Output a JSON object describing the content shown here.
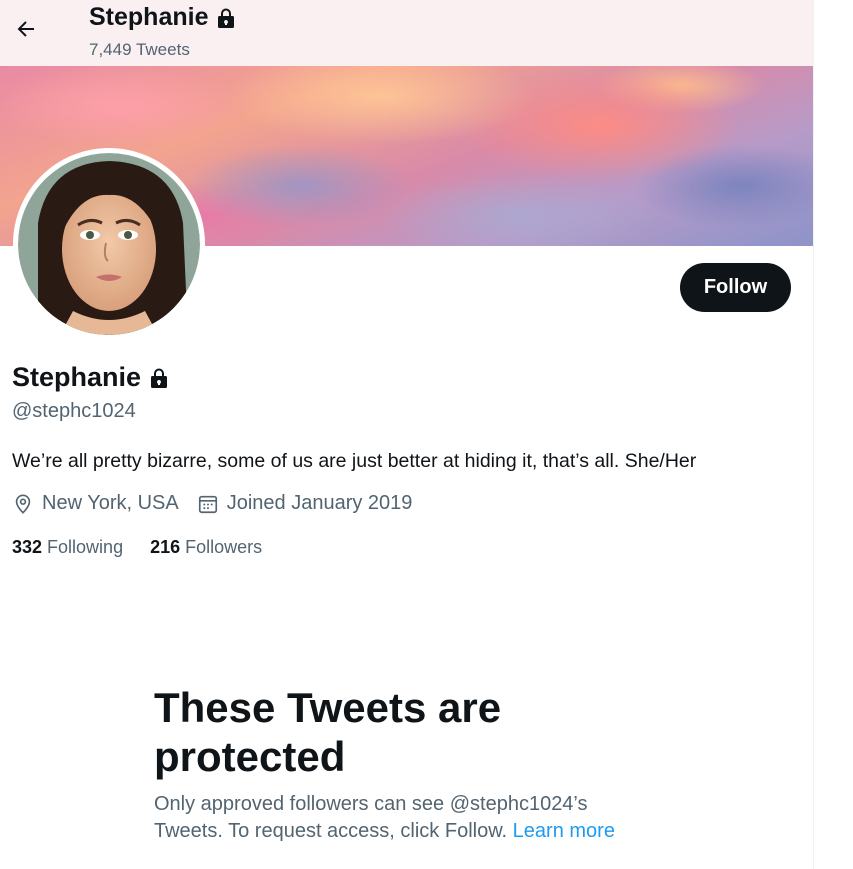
{
  "header": {
    "name": "Stephanie",
    "tweet_count": "7,449 Tweets"
  },
  "profile": {
    "name": "Stephanie",
    "handle": "@stephc1024",
    "bio": "We’re all pretty bizarre, some of us are just better at hiding it, that’s all. She/Her",
    "location": "New York, USA",
    "joined": "Joined January 2019",
    "following_count": "332",
    "following_label": "Following",
    "followers_count": "216",
    "followers_label": "Followers",
    "follow_button": "Follow"
  },
  "protected_notice": {
    "title": "These Tweets are protected",
    "body": "Only approved followers can see @stephc1024’s Tweets. To request access, click Follow.",
    "link": "Learn more"
  },
  "icons": {
    "back": "arrow-left-icon",
    "lock": "lock-icon",
    "location": "location-pin-icon",
    "calendar": "calendar-icon"
  },
  "colors": {
    "text": "#0f1419",
    "secondary": "#536471",
    "link": "#1d9bf0",
    "button": "#0f1419"
  }
}
